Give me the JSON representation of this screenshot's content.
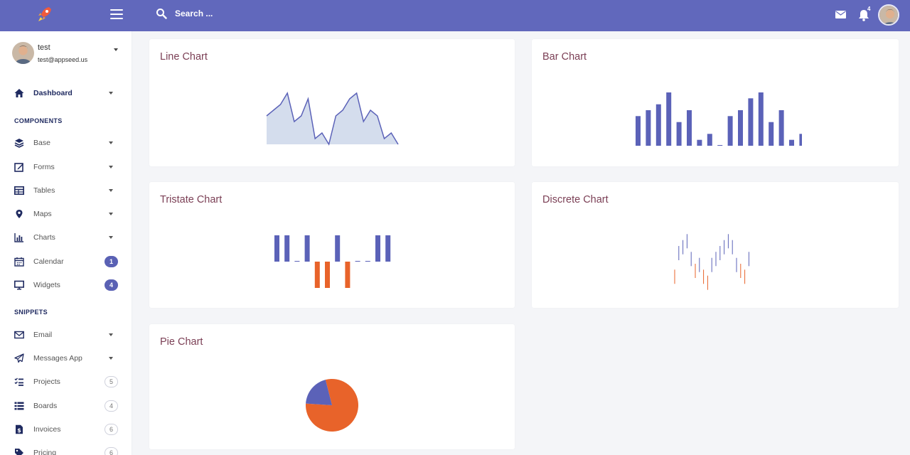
{
  "topbar": {
    "search_placeholder": "Search ...",
    "notification_count": "4",
    "color": "#6168bc"
  },
  "user": {
    "name": "test",
    "email": "test@appseed.us"
  },
  "nav": {
    "dashboard": "Dashboard",
    "components_title": "COMPONENTS",
    "base": "Base",
    "forms": "Forms",
    "tables": "Tables",
    "maps": "Maps",
    "charts": "Charts",
    "calendar": "Calendar",
    "calendar_badge": "1",
    "widgets": "Widgets",
    "widgets_badge": "4",
    "snippets_title": "SNIPPETS",
    "email": "Email",
    "messages": "Messages App",
    "projects": "Projects",
    "projects_badge": "5",
    "boards": "Boards",
    "boards_badge": "4",
    "invoices": "Invoices",
    "invoices_badge": "6",
    "pricing": "Pricing",
    "pricing_badge": "6"
  },
  "cards": {
    "line": "Line Chart",
    "bar": "Bar Chart",
    "tristate": "Tristate Chart",
    "discrete": "Discrete Chart",
    "pie": "Pie Chart"
  },
  "colors": {
    "primary": "#5b62b8",
    "accent": "#e8632a",
    "area_fill": "#cdd7ea"
  },
  "chart_data": [
    {
      "type": "area",
      "name": "line",
      "values": [
        5,
        6,
        7,
        9,
        4,
        5,
        8,
        1,
        2,
        0,
        5,
        6,
        8,
        9,
        4,
        6,
        5,
        1,
        2,
        0
      ]
    },
    {
      "type": "bar",
      "name": "bar",
      "values": [
        5,
        6,
        7,
        9,
        4,
        6,
        1,
        2,
        0,
        5,
        6,
        8,
        9,
        4,
        6,
        1,
        2,
        0
      ]
    },
    {
      "type": "bar",
      "name": "tristate",
      "values": [
        1,
        1,
        0,
        1,
        -1,
        -1,
        1,
        -1,
        0,
        0,
        1,
        1
      ]
    },
    {
      "type": "bar",
      "name": "discrete",
      "values": [
        2,
        6,
        7,
        8,
        5,
        3,
        4,
        2,
        1,
        4,
        5,
        6,
        7,
        8,
        7,
        4,
        3,
        2,
        5
      ]
    },
    {
      "type": "pie",
      "name": "pie",
      "values": [
        80,
        20
      ]
    }
  ]
}
